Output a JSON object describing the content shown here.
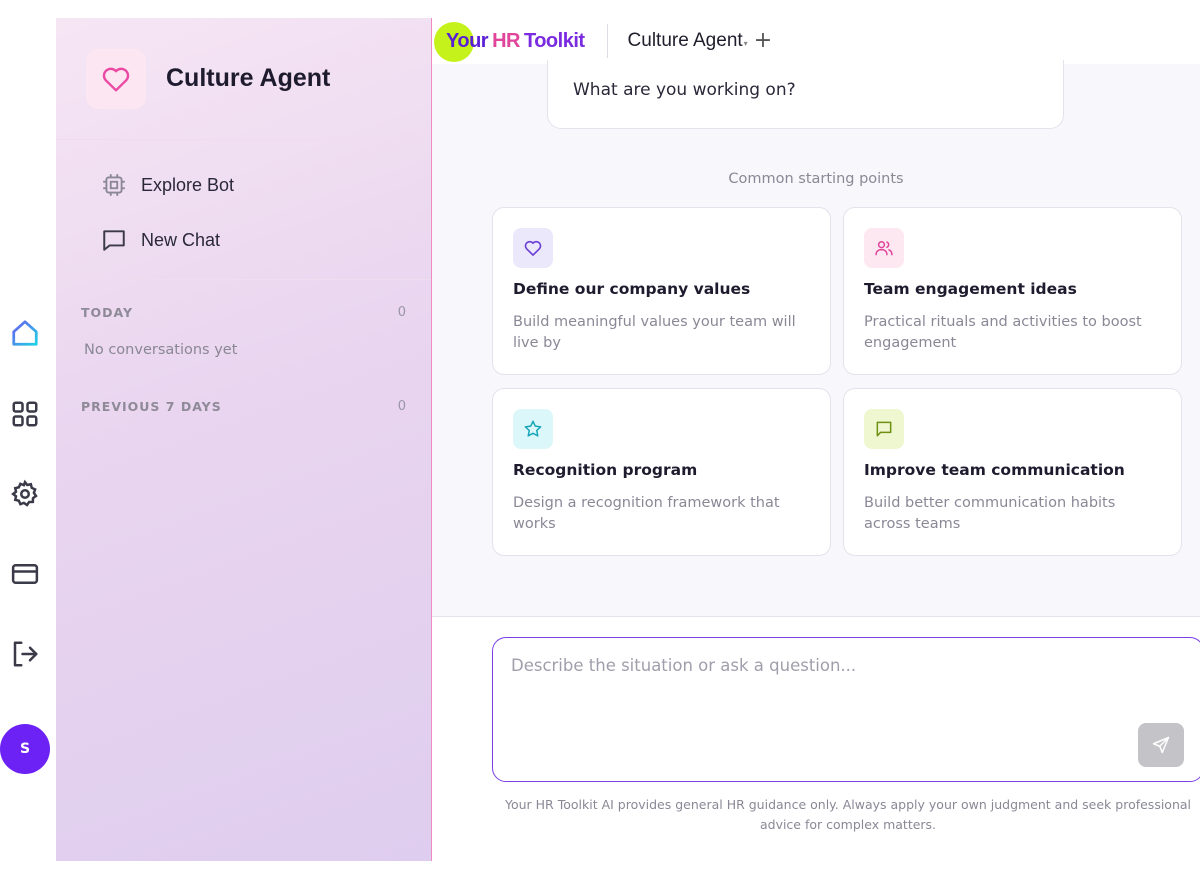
{
  "sidebar": {
    "title": "Culture Agent",
    "actions": [
      {
        "label": "Explore Bot",
        "icon": "cpu-chip-icon"
      },
      {
        "label": "New Chat",
        "icon": "chat-bubble-icon"
      }
    ],
    "sections": [
      {
        "label": "TODAY",
        "count": "0",
        "empty_text": "No conversations yet"
      },
      {
        "label": "PREVIOUS 7 DAYS",
        "count": "0"
      }
    ]
  },
  "rail": {
    "items": [
      "home-icon",
      "grid-icon",
      "settings-icon",
      "credit-card-icon",
      "logout-icon"
    ],
    "avatar_initial": "S"
  },
  "topbar": {
    "brand_your": "Your",
    "brand_hr": "HR",
    "brand_toolkit": "Toolkit",
    "agent_name": "Culture Agent",
    "caret": "▾",
    "plus": "+"
  },
  "chat": {
    "bubble_text": "What are you working on?",
    "starting_points_label": "Common starting points",
    "cards": [
      {
        "title": "Define our company values",
        "desc": "Build meaningful values your team will live by",
        "icon": "heart-icon",
        "icon_bg": "#ece8fb",
        "icon_color": "#6b3fd6"
      },
      {
        "title": "Team engagement ideas",
        "desc": "Practical rituals and activities to boost engagement",
        "icon": "users-icon",
        "icon_bg": "#fde7f1",
        "icon_color": "#e0449b"
      },
      {
        "title": "Recognition program",
        "desc": "Design a recognition framework that works",
        "icon": "star-icon",
        "icon_bg": "#dcf7fa",
        "icon_color": "#18a7b8"
      },
      {
        "title": "Improve team communication",
        "desc": "Build better communication habits across teams",
        "icon": "message-square-icon",
        "icon_bg": "#eef7cf",
        "icon_color": "#6f8f12"
      }
    ]
  },
  "composer": {
    "placeholder": "Describe the situation or ask a question...",
    "send_icon": "send-icon",
    "disclaimer": "Your HR Toolkit AI provides general HR guidance only. Always apply your own judgment and seek professional advice for complex matters."
  },
  "colors": {
    "accent": "#6c21f5",
    "brand_lime": "#c6f21b",
    "brand_pink": "#e0449b",
    "home_icon": "#1fc4e6"
  }
}
